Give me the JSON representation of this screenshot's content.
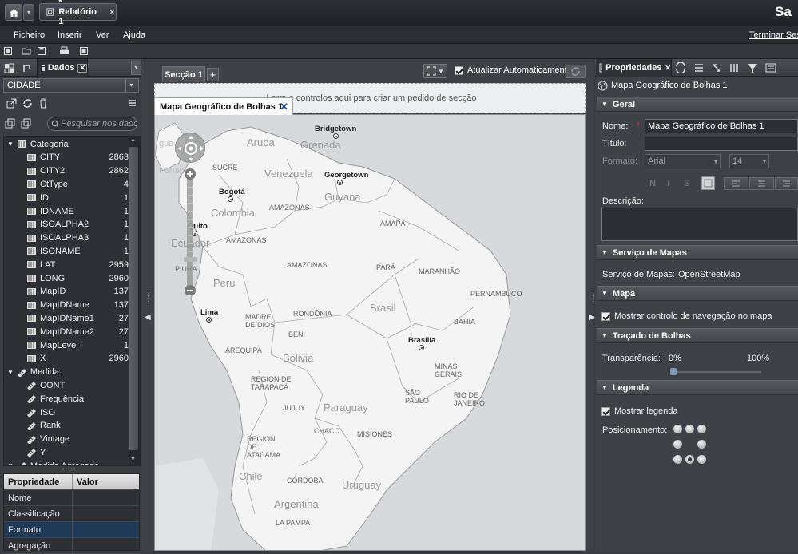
{
  "app": {
    "doc_tab_title": "* Relatório 1",
    "logo_text": "Sa",
    "logout_label": "Terminar Ses"
  },
  "menu": [
    "Ficheiro",
    "Inserir",
    "Ver",
    "Ajuda"
  ],
  "left_panel": {
    "tab_label": "Dados",
    "data_source": "CIDADE",
    "search_placeholder": "Pesquisar nos dados",
    "tree": {
      "categoria_label": "Categoria",
      "categoria_items": [
        {
          "name": "CITY",
          "count": "2863"
        },
        {
          "name": "CITY2",
          "count": "2862"
        },
        {
          "name": "CtType",
          "count": "4"
        },
        {
          "name": "ID",
          "count": "1"
        },
        {
          "name": "IDNAME",
          "count": "1"
        },
        {
          "name": "ISOALPHA2",
          "count": "1"
        },
        {
          "name": "ISOALPHA3",
          "count": "1"
        },
        {
          "name": "ISONAME",
          "count": "1"
        },
        {
          "name": "LAT",
          "count": "2959"
        },
        {
          "name": "LONG",
          "count": "2960"
        },
        {
          "name": "MapID",
          "count": "137"
        },
        {
          "name": "MapIDName",
          "count": "137"
        },
        {
          "name": "MapIDName1",
          "count": "27"
        },
        {
          "name": "MapIDName2",
          "count": "27"
        },
        {
          "name": "MapLevel",
          "count": "1"
        },
        {
          "name": "X",
          "count": "2960"
        }
      ],
      "medida_label": "Medida",
      "medida_items": [
        "CONT",
        "Frequência",
        "ISO",
        "Rank",
        "Vintage",
        "Y"
      ],
      "medida_agregada_label": "Medida Agregada"
    },
    "prop_table": {
      "headers": [
        "Propriedade",
        "Valor"
      ],
      "rows": [
        "Nome",
        "Classificação",
        "Formato",
        "Agregação"
      ]
    }
  },
  "center": {
    "section_tab": "Secção 1",
    "auto_update_label": "Atualizar Automaticamente",
    "drop_hint": "Largue controlos aqui para criar um pedido de secção",
    "map_tab_title": "Mapa Geográfico de Bolhas 1",
    "map_labels": {
      "capitals": [
        "Bridgetown",
        "Georgetown",
        "Bogotá",
        "Quito",
        "Lima",
        "Brasília"
      ],
      "countries": [
        "Aruba",
        "Grenada",
        "Venezuela",
        "Guyana",
        "Colombia",
        "Ecuador",
        "Peru",
        "Brasil",
        "Bolivia",
        "Paraguay",
        "Chile",
        "Argentina",
        "Uruguay"
      ],
      "regions": [
        "SUCRE",
        "AMAZONAS",
        "AMAZONAS",
        "AMAPÁ",
        "AMAZONAS",
        "PARÁ",
        "MARANHÃO",
        "PIURA",
        "PERNAMBUCO",
        "RONDÔNIA",
        "MADRE DE DIOS",
        "BAHIA",
        "BENI",
        "AREQUIPA",
        "MINAS GERAIS",
        "REGION DE TARAPACÁ",
        "SÃO PAULO",
        "RIO DE JANEIRO",
        "JUJUY",
        "CHACO",
        "MISIONES",
        "REGION DE ATACAMA",
        "CÓRDOBA",
        "LA PAMPA"
      ],
      "sea": [
        "gua",
        "Panam"
      ]
    }
  },
  "right_panel": {
    "tab_label": "Propriedades",
    "object_name": "Mapa Geográfico de Bolhas 1",
    "geral": {
      "header": "Geral",
      "nome_label": "Nome:",
      "nome_value": "Mapa Geográfico de Bolhas 1",
      "titulo_label": "Título:",
      "titulo_value": "",
      "formato_label": "Formato:",
      "font_value": "Arial",
      "size_value": "14",
      "descricao_label": "Descrição:"
    },
    "servico": {
      "header": "Serviço de Mapas",
      "label": "Serviço de Mapas:",
      "value": "OpenStreetMap"
    },
    "mapa": {
      "header": "Mapa",
      "nav_label": "Mostrar controlo de navegação no mapa"
    },
    "tracado": {
      "header": "Traçado de Bolhas",
      "transp_label": "Transparência:",
      "min_label": "0%",
      "max_label": "100%",
      "transparency_value": 0
    },
    "legenda": {
      "header": "Legenda",
      "show_label": "Mostrar legenda",
      "pos_label": "Posicionamento:",
      "selected_position": "bottom-center"
    }
  },
  "colors": {
    "chrome_dark": "#2a2d32",
    "panel_bg": "#3e4146",
    "selection": "#1f3a57",
    "map_land": "#f4f4f4",
    "map_sea": "#d7d9dc",
    "required_marker": "#e03030"
  }
}
